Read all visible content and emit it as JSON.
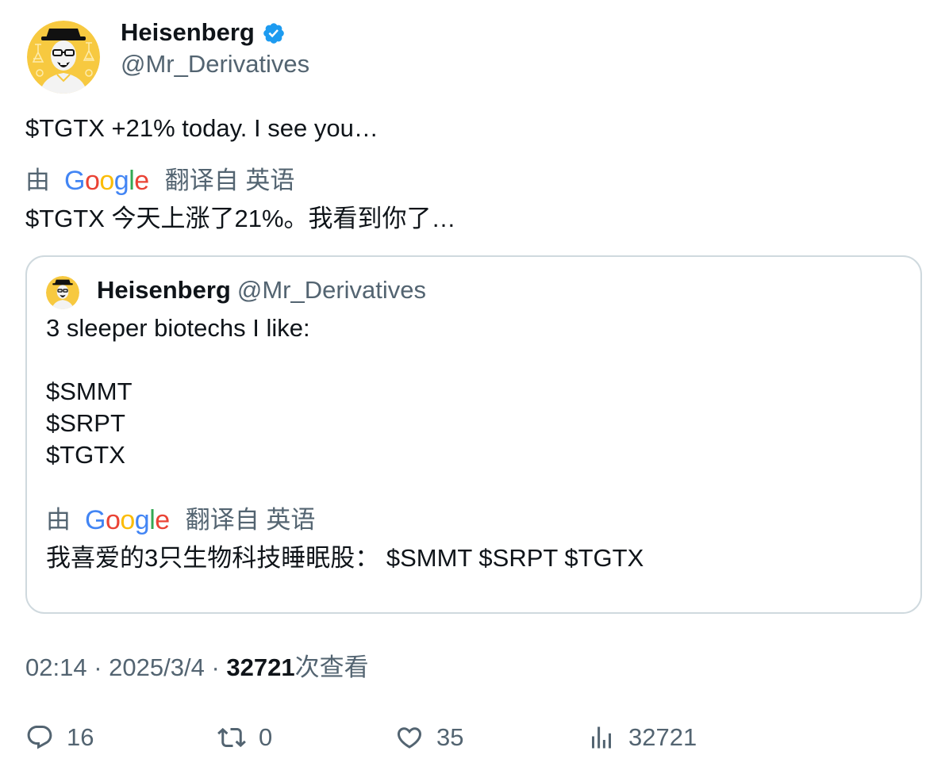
{
  "author": {
    "name": "Heisenberg",
    "handle": "@Mr_Derivatives"
  },
  "tweet": {
    "text": "$TGTX +21% today. I see you…",
    "translation": {
      "by_label": "由",
      "provider": "Google",
      "from_label": "翻译自 英语",
      "text": "$TGTX 今天上涨了21%。我看到你了…"
    }
  },
  "quoted_tweet": {
    "name": "Heisenberg",
    "handle": "@Mr_Derivatives",
    "lines": [
      "3 sleeper biotechs I like:",
      "$SMMT",
      "$SRPT",
      "$TGTX"
    ],
    "translation": {
      "by_label": "由",
      "provider": "Google",
      "from_label": "翻译自 英语",
      "text": "我喜爱的3只生物科技睡眠股： $SMMT $SRPT $TGTX"
    }
  },
  "meta": {
    "time": "02:14",
    "separator": "·",
    "date": "2025/3/4",
    "views": "32721",
    "views_suffix": "次查看"
  },
  "actions": {
    "replies": "16",
    "reposts": "0",
    "likes": "35",
    "views": "32721"
  },
  "colors": {
    "text": "#0f1419",
    "secondary": "#536471",
    "border": "#cfd9de",
    "verified": "#1d9bf0",
    "avatar_bg": "#f7c940"
  }
}
